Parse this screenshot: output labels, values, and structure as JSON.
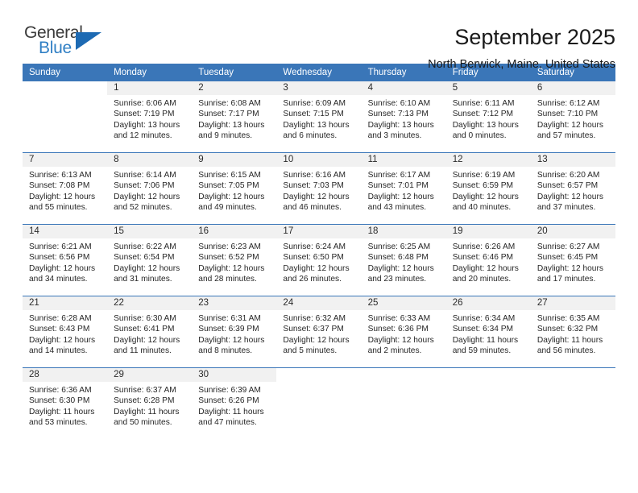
{
  "brand": {
    "name_part1": "General",
    "name_part2": "Blue",
    "triangle_color": "#1d6ab3",
    "blue_text_color": "#2f7fc4"
  },
  "header": {
    "title": "September 2025",
    "subtitle": "North Berwick, Maine, United States"
  },
  "theme": {
    "header_blue": "#3a76b8",
    "daynum_band": "#f1f1f1",
    "text": "#262626"
  },
  "weekday_headers": [
    "Sunday",
    "Monday",
    "Tuesday",
    "Wednesday",
    "Thursday",
    "Friday",
    "Saturday"
  ],
  "weeks": [
    [
      {
        "day": "",
        "sunrise": "",
        "sunset": "",
        "daylight1": "",
        "daylight2": ""
      },
      {
        "day": "1",
        "sunrise": "Sunrise: 6:06 AM",
        "sunset": "Sunset: 7:19 PM",
        "daylight1": "Daylight: 13 hours",
        "daylight2": "and 12 minutes."
      },
      {
        "day": "2",
        "sunrise": "Sunrise: 6:08 AM",
        "sunset": "Sunset: 7:17 PM",
        "daylight1": "Daylight: 13 hours",
        "daylight2": "and 9 minutes."
      },
      {
        "day": "3",
        "sunrise": "Sunrise: 6:09 AM",
        "sunset": "Sunset: 7:15 PM",
        "daylight1": "Daylight: 13 hours",
        "daylight2": "and 6 minutes."
      },
      {
        "day": "4",
        "sunrise": "Sunrise: 6:10 AM",
        "sunset": "Sunset: 7:13 PM",
        "daylight1": "Daylight: 13 hours",
        "daylight2": "and 3 minutes."
      },
      {
        "day": "5",
        "sunrise": "Sunrise: 6:11 AM",
        "sunset": "Sunset: 7:12 PM",
        "daylight1": "Daylight: 13 hours",
        "daylight2": "and 0 minutes."
      },
      {
        "day": "6",
        "sunrise": "Sunrise: 6:12 AM",
        "sunset": "Sunset: 7:10 PM",
        "daylight1": "Daylight: 12 hours",
        "daylight2": "and 57 minutes."
      }
    ],
    [
      {
        "day": "7",
        "sunrise": "Sunrise: 6:13 AM",
        "sunset": "Sunset: 7:08 PM",
        "daylight1": "Daylight: 12 hours",
        "daylight2": "and 55 minutes."
      },
      {
        "day": "8",
        "sunrise": "Sunrise: 6:14 AM",
        "sunset": "Sunset: 7:06 PM",
        "daylight1": "Daylight: 12 hours",
        "daylight2": "and 52 minutes."
      },
      {
        "day": "9",
        "sunrise": "Sunrise: 6:15 AM",
        "sunset": "Sunset: 7:05 PM",
        "daylight1": "Daylight: 12 hours",
        "daylight2": "and 49 minutes."
      },
      {
        "day": "10",
        "sunrise": "Sunrise: 6:16 AM",
        "sunset": "Sunset: 7:03 PM",
        "daylight1": "Daylight: 12 hours",
        "daylight2": "and 46 minutes."
      },
      {
        "day": "11",
        "sunrise": "Sunrise: 6:17 AM",
        "sunset": "Sunset: 7:01 PM",
        "daylight1": "Daylight: 12 hours",
        "daylight2": "and 43 minutes."
      },
      {
        "day": "12",
        "sunrise": "Sunrise: 6:19 AM",
        "sunset": "Sunset: 6:59 PM",
        "daylight1": "Daylight: 12 hours",
        "daylight2": "and 40 minutes."
      },
      {
        "day": "13",
        "sunrise": "Sunrise: 6:20 AM",
        "sunset": "Sunset: 6:57 PM",
        "daylight1": "Daylight: 12 hours",
        "daylight2": "and 37 minutes."
      }
    ],
    [
      {
        "day": "14",
        "sunrise": "Sunrise: 6:21 AM",
        "sunset": "Sunset: 6:56 PM",
        "daylight1": "Daylight: 12 hours",
        "daylight2": "and 34 minutes."
      },
      {
        "day": "15",
        "sunrise": "Sunrise: 6:22 AM",
        "sunset": "Sunset: 6:54 PM",
        "daylight1": "Daylight: 12 hours",
        "daylight2": "and 31 minutes."
      },
      {
        "day": "16",
        "sunrise": "Sunrise: 6:23 AM",
        "sunset": "Sunset: 6:52 PM",
        "daylight1": "Daylight: 12 hours",
        "daylight2": "and 28 minutes."
      },
      {
        "day": "17",
        "sunrise": "Sunrise: 6:24 AM",
        "sunset": "Sunset: 6:50 PM",
        "daylight1": "Daylight: 12 hours",
        "daylight2": "and 26 minutes."
      },
      {
        "day": "18",
        "sunrise": "Sunrise: 6:25 AM",
        "sunset": "Sunset: 6:48 PM",
        "daylight1": "Daylight: 12 hours",
        "daylight2": "and 23 minutes."
      },
      {
        "day": "19",
        "sunrise": "Sunrise: 6:26 AM",
        "sunset": "Sunset: 6:46 PM",
        "daylight1": "Daylight: 12 hours",
        "daylight2": "and 20 minutes."
      },
      {
        "day": "20",
        "sunrise": "Sunrise: 6:27 AM",
        "sunset": "Sunset: 6:45 PM",
        "daylight1": "Daylight: 12 hours",
        "daylight2": "and 17 minutes."
      }
    ],
    [
      {
        "day": "21",
        "sunrise": "Sunrise: 6:28 AM",
        "sunset": "Sunset: 6:43 PM",
        "daylight1": "Daylight: 12 hours",
        "daylight2": "and 14 minutes."
      },
      {
        "day": "22",
        "sunrise": "Sunrise: 6:30 AM",
        "sunset": "Sunset: 6:41 PM",
        "daylight1": "Daylight: 12 hours",
        "daylight2": "and 11 minutes."
      },
      {
        "day": "23",
        "sunrise": "Sunrise: 6:31 AM",
        "sunset": "Sunset: 6:39 PM",
        "daylight1": "Daylight: 12 hours",
        "daylight2": "and 8 minutes."
      },
      {
        "day": "24",
        "sunrise": "Sunrise: 6:32 AM",
        "sunset": "Sunset: 6:37 PM",
        "daylight1": "Daylight: 12 hours",
        "daylight2": "and 5 minutes."
      },
      {
        "day": "25",
        "sunrise": "Sunrise: 6:33 AM",
        "sunset": "Sunset: 6:36 PM",
        "daylight1": "Daylight: 12 hours",
        "daylight2": "and 2 minutes."
      },
      {
        "day": "26",
        "sunrise": "Sunrise: 6:34 AM",
        "sunset": "Sunset: 6:34 PM",
        "daylight1": "Daylight: 11 hours",
        "daylight2": "and 59 minutes."
      },
      {
        "day": "27",
        "sunrise": "Sunrise: 6:35 AM",
        "sunset": "Sunset: 6:32 PM",
        "daylight1": "Daylight: 11 hours",
        "daylight2": "and 56 minutes."
      }
    ],
    [
      {
        "day": "28",
        "sunrise": "Sunrise: 6:36 AM",
        "sunset": "Sunset: 6:30 PM",
        "daylight1": "Daylight: 11 hours",
        "daylight2": "and 53 minutes."
      },
      {
        "day": "29",
        "sunrise": "Sunrise: 6:37 AM",
        "sunset": "Sunset: 6:28 PM",
        "daylight1": "Daylight: 11 hours",
        "daylight2": "and 50 minutes."
      },
      {
        "day": "30",
        "sunrise": "Sunrise: 6:39 AM",
        "sunset": "Sunset: 6:26 PM",
        "daylight1": "Daylight: 11 hours",
        "daylight2": "and 47 minutes."
      },
      {
        "day": "",
        "sunrise": "",
        "sunset": "",
        "daylight1": "",
        "daylight2": ""
      },
      {
        "day": "",
        "sunrise": "",
        "sunset": "",
        "daylight1": "",
        "daylight2": ""
      },
      {
        "day": "",
        "sunrise": "",
        "sunset": "",
        "daylight1": "",
        "daylight2": ""
      },
      {
        "day": "",
        "sunrise": "",
        "sunset": "",
        "daylight1": "",
        "daylight2": ""
      }
    ]
  ]
}
